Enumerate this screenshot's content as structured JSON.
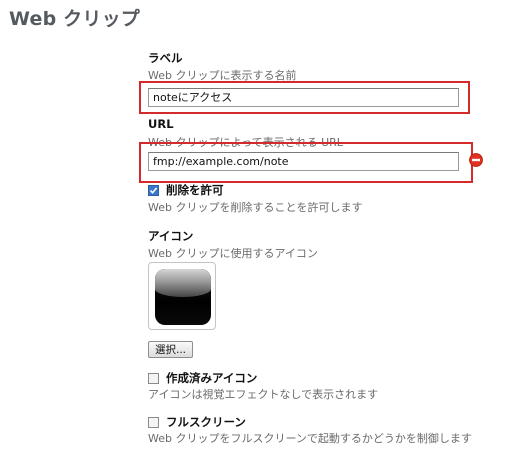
{
  "page": {
    "title": "Web クリップ"
  },
  "label_field": {
    "heading": "ラベル",
    "description": "Web クリップに表示する名前",
    "value": "noteにアクセス"
  },
  "url_field": {
    "heading": "URL",
    "description": "Web クリップによって表示される URL",
    "value": "fmp://example.com/note"
  },
  "removable": {
    "label": "削除を許可",
    "description": "Web クリップを削除することを許可します",
    "checked": true
  },
  "icon_section": {
    "heading": "アイコン",
    "description": "Web クリップに使用するアイコン",
    "select_label": "選択..."
  },
  "precomposed": {
    "label": "作成済みアイコン",
    "description": "アイコンは視覚エフェクトなしで表示されます",
    "checked": false
  },
  "fullscreen": {
    "label": "フルスクリーン",
    "description": "Web クリップをフルスクリーンで起動するかどうかを制御します",
    "checked": false
  },
  "colors": {
    "highlight": "#d42a2a",
    "remove_icon": "#e0301e",
    "checkbox_checked": "#3b76c8"
  },
  "icons": {
    "remove": "minus-circle-icon",
    "check": "checkmark-icon",
    "webclip": "webclip-preview-icon"
  }
}
